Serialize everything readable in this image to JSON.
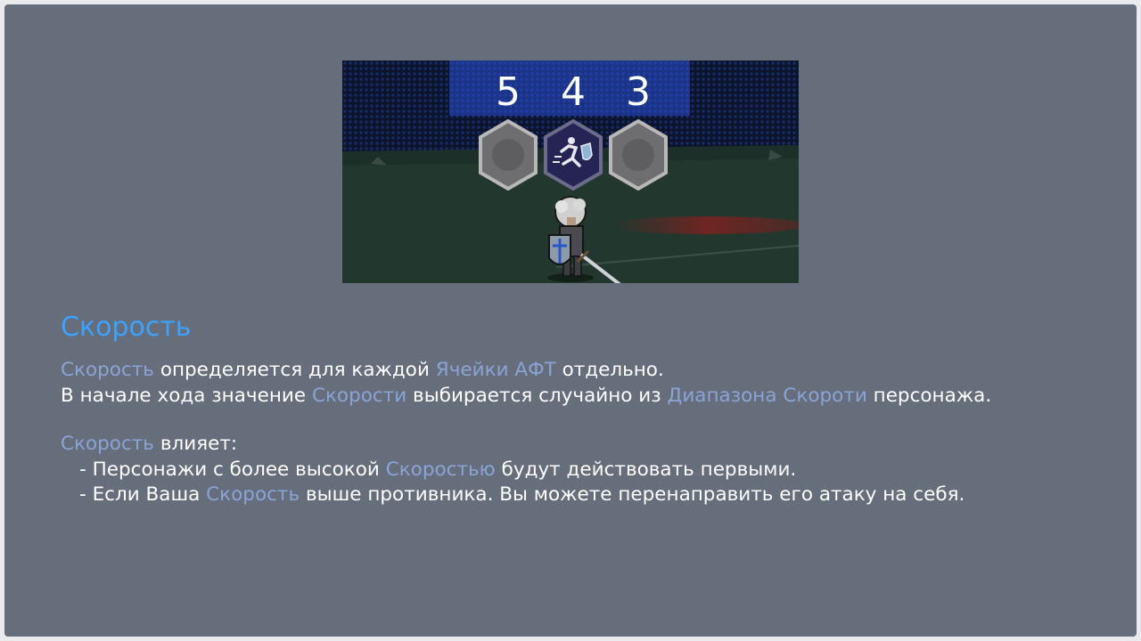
{
  "scene": {
    "speeds": [
      "5",
      "4",
      "3"
    ],
    "slots": [
      {
        "state": "empty",
        "icon": "empty-slot-icon"
      },
      {
        "state": "active",
        "icon": "running-shield-icon"
      },
      {
        "state": "empty",
        "icon": "empty-slot-icon"
      }
    ],
    "colors": {
      "banner": "#1e3a9e",
      "ground": "#22382f",
      "active_slot": "#262454",
      "empty_slot": "#6e6e70"
    }
  },
  "title": "Скорость",
  "lines": [
    {
      "t1": "Скорость",
      "t2": " определяется для каждой ",
      "t3": "Ячейки АФТ",
      "t4": " отдельно."
    },
    {
      "t1": "В начале хода значение ",
      "t2": "Скорости",
      "t3": " выбирается случайно из ",
      "t4": "Диапазона Скороти",
      "t5": " персонажа."
    },
    {
      "t1": "Скорость",
      "t2": " влияет:"
    },
    {
      "t1": "- Персонажи с более высокой ",
      "t2": "Скоростью",
      "t3": " будут действовать первыми."
    },
    {
      "t1": "- Если Ваша ",
      "t2": "Скорость",
      "t3": " выше противника. Вы можете перенаправить его атаку на себя."
    }
  ],
  "colors": {
    "panel": "#666d7b",
    "title": "#3aa3ff",
    "keyword": "#8aa4d6",
    "text": "#ffffff"
  }
}
